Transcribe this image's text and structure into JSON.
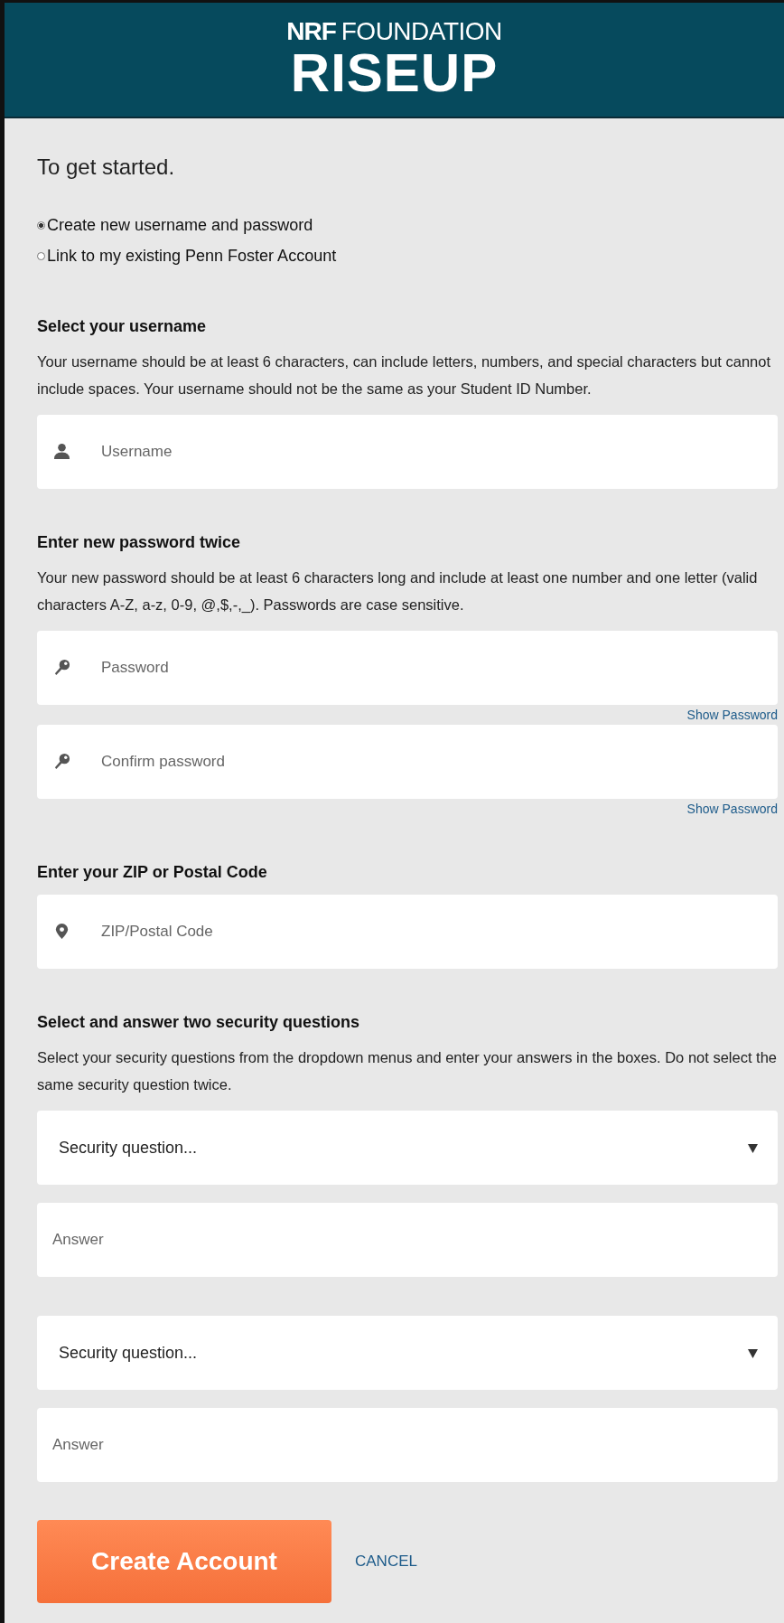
{
  "header": {
    "brand_bold": "NRF",
    "brand_light": "FOUNDATION",
    "brand_main": "RISEUP"
  },
  "intro": "To get started.",
  "account_options": [
    {
      "label": "Create new username and password",
      "selected": true
    },
    {
      "label": "Link to my existing Penn Foster Account",
      "selected": false
    }
  ],
  "sections": [
    {
      "heading": "Select your username",
      "description": "Your username should be at least 6 characters, can include letters, numbers, and special characters but cannot include spaces. Your username should not be the same as your Student ID Number.",
      "fields": [
        {
          "kind": "username",
          "placeholder": "Username"
        }
      ]
    },
    {
      "heading": "Enter new password twice",
      "description": "Your new password should be at least 6 characters long and include at least one number and one letter (valid characters A-Z, a-z, 0-9, @,$,-,_). Passwords are case sensitive.",
      "fields": [
        {
          "kind": "password",
          "placeholder": "Password",
          "link": "Show Password"
        },
        {
          "kind": "password",
          "placeholder": "Confirm password",
          "link": "Show Password"
        }
      ]
    },
    {
      "heading": "Enter your ZIP or Postal Code",
      "fields": [
        {
          "kind": "zip",
          "placeholder": "ZIP/Postal Code"
        }
      ]
    },
    {
      "heading": "Select and answer two security questions",
      "description": "Select your security questions from the dropdown menus and enter your answers in the boxes. Do not select the same security question twice.",
      "fields": [
        {
          "kind": "select",
          "value": "Security question..."
        },
        {
          "kind": "answer",
          "placeholder": "Answer"
        },
        {
          "kind": "select",
          "value": "Security question..."
        },
        {
          "kind": "answer",
          "placeholder": "Answer"
        }
      ]
    }
  ],
  "actions": {
    "primary": "Create Account",
    "secondary": "CANCEL"
  }
}
